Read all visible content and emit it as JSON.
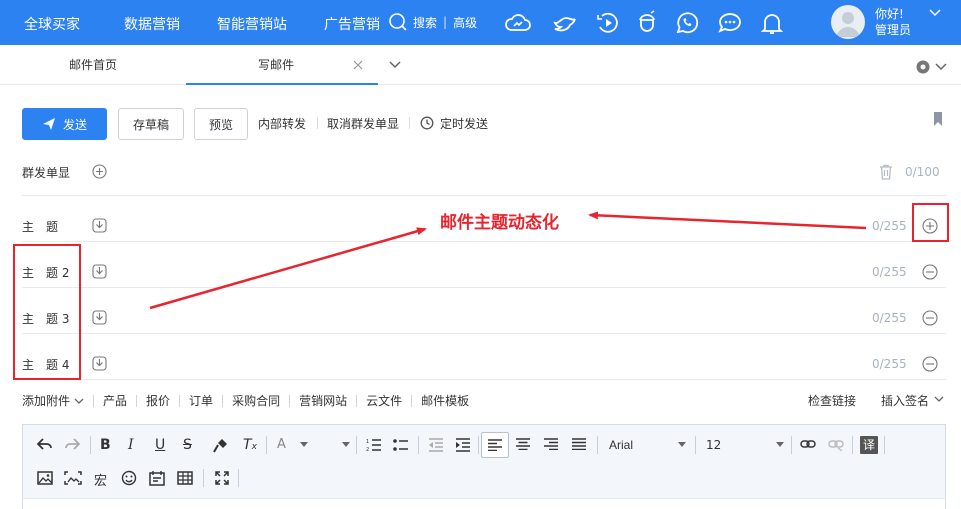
{
  "nav": {
    "items": [
      "全球买家",
      "数据营销",
      "智能营销站",
      "广告营销"
    ],
    "search_label": "搜索",
    "advanced_label": "高级",
    "greeting": "你好!",
    "username": "管理员"
  },
  "tabs": {
    "home": "邮件首页",
    "compose": "写邮件"
  },
  "toolbar": {
    "send": "发送",
    "save_draft": "存草稿",
    "preview": "预览",
    "internal_forward": "内部转发",
    "cancel_group_single": "取消群发单显",
    "scheduled_send": "定时发送"
  },
  "recipients": {
    "label": "群发单显",
    "count": "0/100"
  },
  "subjects": [
    {
      "label": "主　题",
      "count": "0/255"
    },
    {
      "label": "主　题 2",
      "count": "0/255"
    },
    {
      "label": "主　题 3",
      "count": "0/255"
    },
    {
      "label": "主　题 4",
      "count": "0/255"
    }
  ],
  "annotation": {
    "text": "邮件主题动态化",
    "color": "#e8242f"
  },
  "attachments": {
    "items": [
      "添加附件",
      "产品",
      "报价",
      "订单",
      "采购合同",
      "营销网站",
      "云文件",
      "邮件模板"
    ],
    "check_links": "检查链接",
    "insert_signature": "插入签名"
  },
  "editor": {
    "font_family": "Arial",
    "font_size": "12"
  },
  "colors": {
    "primary": "#2d82f2",
    "annotation": "#e8242f"
  }
}
